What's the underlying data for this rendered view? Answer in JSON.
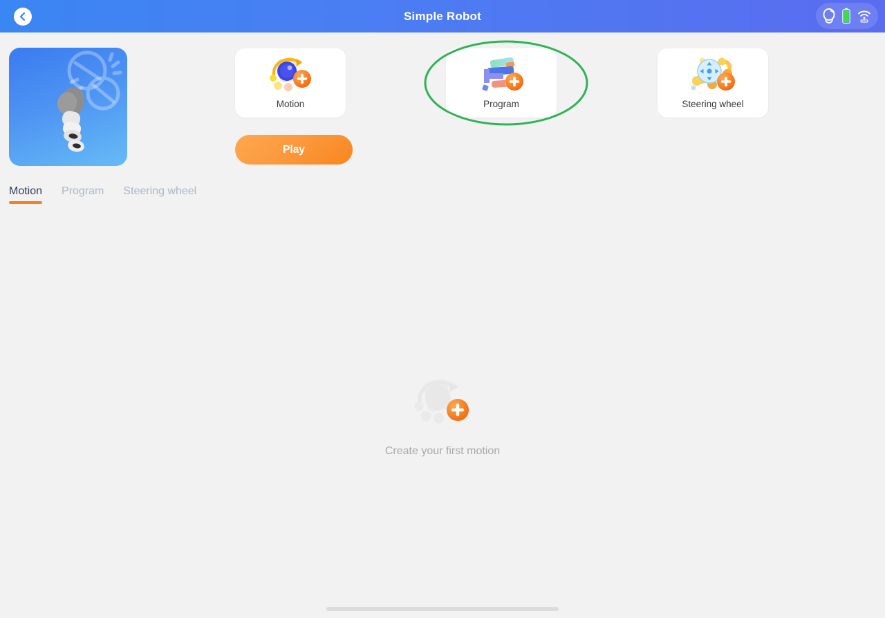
{
  "header": {
    "title": "Simple Robot",
    "back_icon": "chevron-left-icon",
    "status": {
      "robot_icon": "robot-connection-icon",
      "battery_icon": "battery-full-icon",
      "wifi_icon": "wifi-signal-icon",
      "battery_color": "#3ddc4a"
    }
  },
  "thumbnail": {
    "name": "robot-preview-thumbnail",
    "gradient_from": "#3a7bf0",
    "gradient_to": "#66bbf6"
  },
  "cards": [
    {
      "label": "Motion",
      "icon": "motion-add-icon"
    },
    {
      "label": "Program",
      "icon": "program-add-icon"
    },
    {
      "label": "Steering wheel",
      "icon": "steering-wheel-add-icon"
    }
  ],
  "annotation": {
    "shape": "ellipse",
    "target": "Program",
    "color": "#2eb355"
  },
  "play_button": {
    "label": "Play",
    "color_from": "#ffa84f",
    "color_to": "#f9861f"
  },
  "tabs": [
    {
      "label": "Motion",
      "active": true
    },
    {
      "label": "Program",
      "active": false
    },
    {
      "label": "Steering wheel",
      "active": false
    }
  ],
  "tab_accent_color": "#f7821b",
  "empty_state": {
    "text": "Create your first motion",
    "icon": "motion-add-placeholder-icon"
  },
  "home_indicator": {
    "name": "home-indicator-bar"
  }
}
